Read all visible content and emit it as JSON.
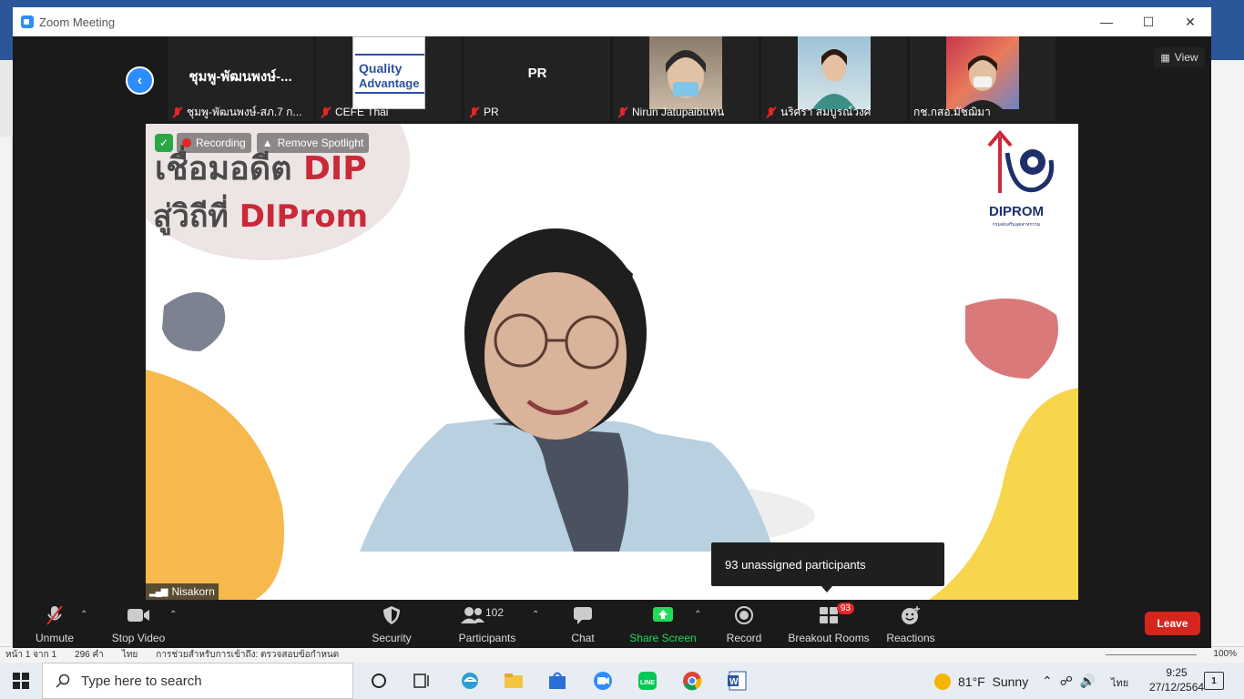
{
  "window": {
    "title": "Zoom Meeting"
  },
  "thumbnails": [
    {
      "big_name": "ชุมพู-พัฒนพงษ์-...",
      "label": "ชุมพู-พัฒนพงษ์-สภ.7 ก...",
      "muted": true,
      "kind": "name"
    },
    {
      "big_name": "",
      "label": "CEFE Thai",
      "muted": true,
      "kind": "logo",
      "logo_line1": "Quality",
      "logo_line2": "Advantage"
    },
    {
      "big_name": "PR",
      "label": "PR",
      "muted": true,
      "kind": "name"
    },
    {
      "big_name": "",
      "label": "Nirun Jatupaibแทน",
      "muted": true,
      "kind": "video"
    },
    {
      "big_name": "",
      "label": "นริศรา สมบูรณ์วงศ์",
      "muted": true,
      "kind": "video"
    },
    {
      "big_name": "",
      "label": "กช.กสอ.มัชฌิมา",
      "muted": false,
      "kind": "video"
    }
  ],
  "view_button": {
    "label": "View"
  },
  "spotlight": {
    "text_line1": "เชื่อมอดีต",
    "text_line1_red": "DIP",
    "text_line2": "สู่วิถีที่",
    "text_line2_red": "DIProm",
    "recording_label": "Recording",
    "remove_spotlight_label": "Remove Spotlight",
    "logo_name": "DIPROM",
    "logo_sub": "กรมส่งเสริมอุตสาหกรรม",
    "speaker_name": "Nisakorn"
  },
  "tooltip": {
    "text": "93 unassigned participants"
  },
  "toolbar": {
    "unmute": "Unmute",
    "stop_video": "Stop Video",
    "security": "Security",
    "participants": "Participants",
    "participants_count": "102",
    "chat": "Chat",
    "share_screen": "Share Screen",
    "record": "Record",
    "breakout_rooms": "Breakout Rooms",
    "breakout_badge": "93",
    "reactions": "Reactions",
    "leave": "Leave"
  },
  "word_status": {
    "page": "หน้า 1 จาก 1",
    "words": "296 คำ",
    "lang": "ไทย",
    "accessibility": "การช่วยสำหรับการเข้าถึง: ตรวจสอบข้อกำหนด",
    "zoom": "100%"
  },
  "taskbar": {
    "search_placeholder": "Type here to search",
    "temperature": "81°F",
    "weather": "Sunny",
    "lang": "ไทย",
    "time": "9:25",
    "date": "27/12/2564",
    "notif_count": "1"
  },
  "colors": {
    "zoom_blue": "#2d8cff",
    "leave_red": "#d5251c",
    "share_green": "#23d959",
    "word_blue": "#2b579a"
  }
}
